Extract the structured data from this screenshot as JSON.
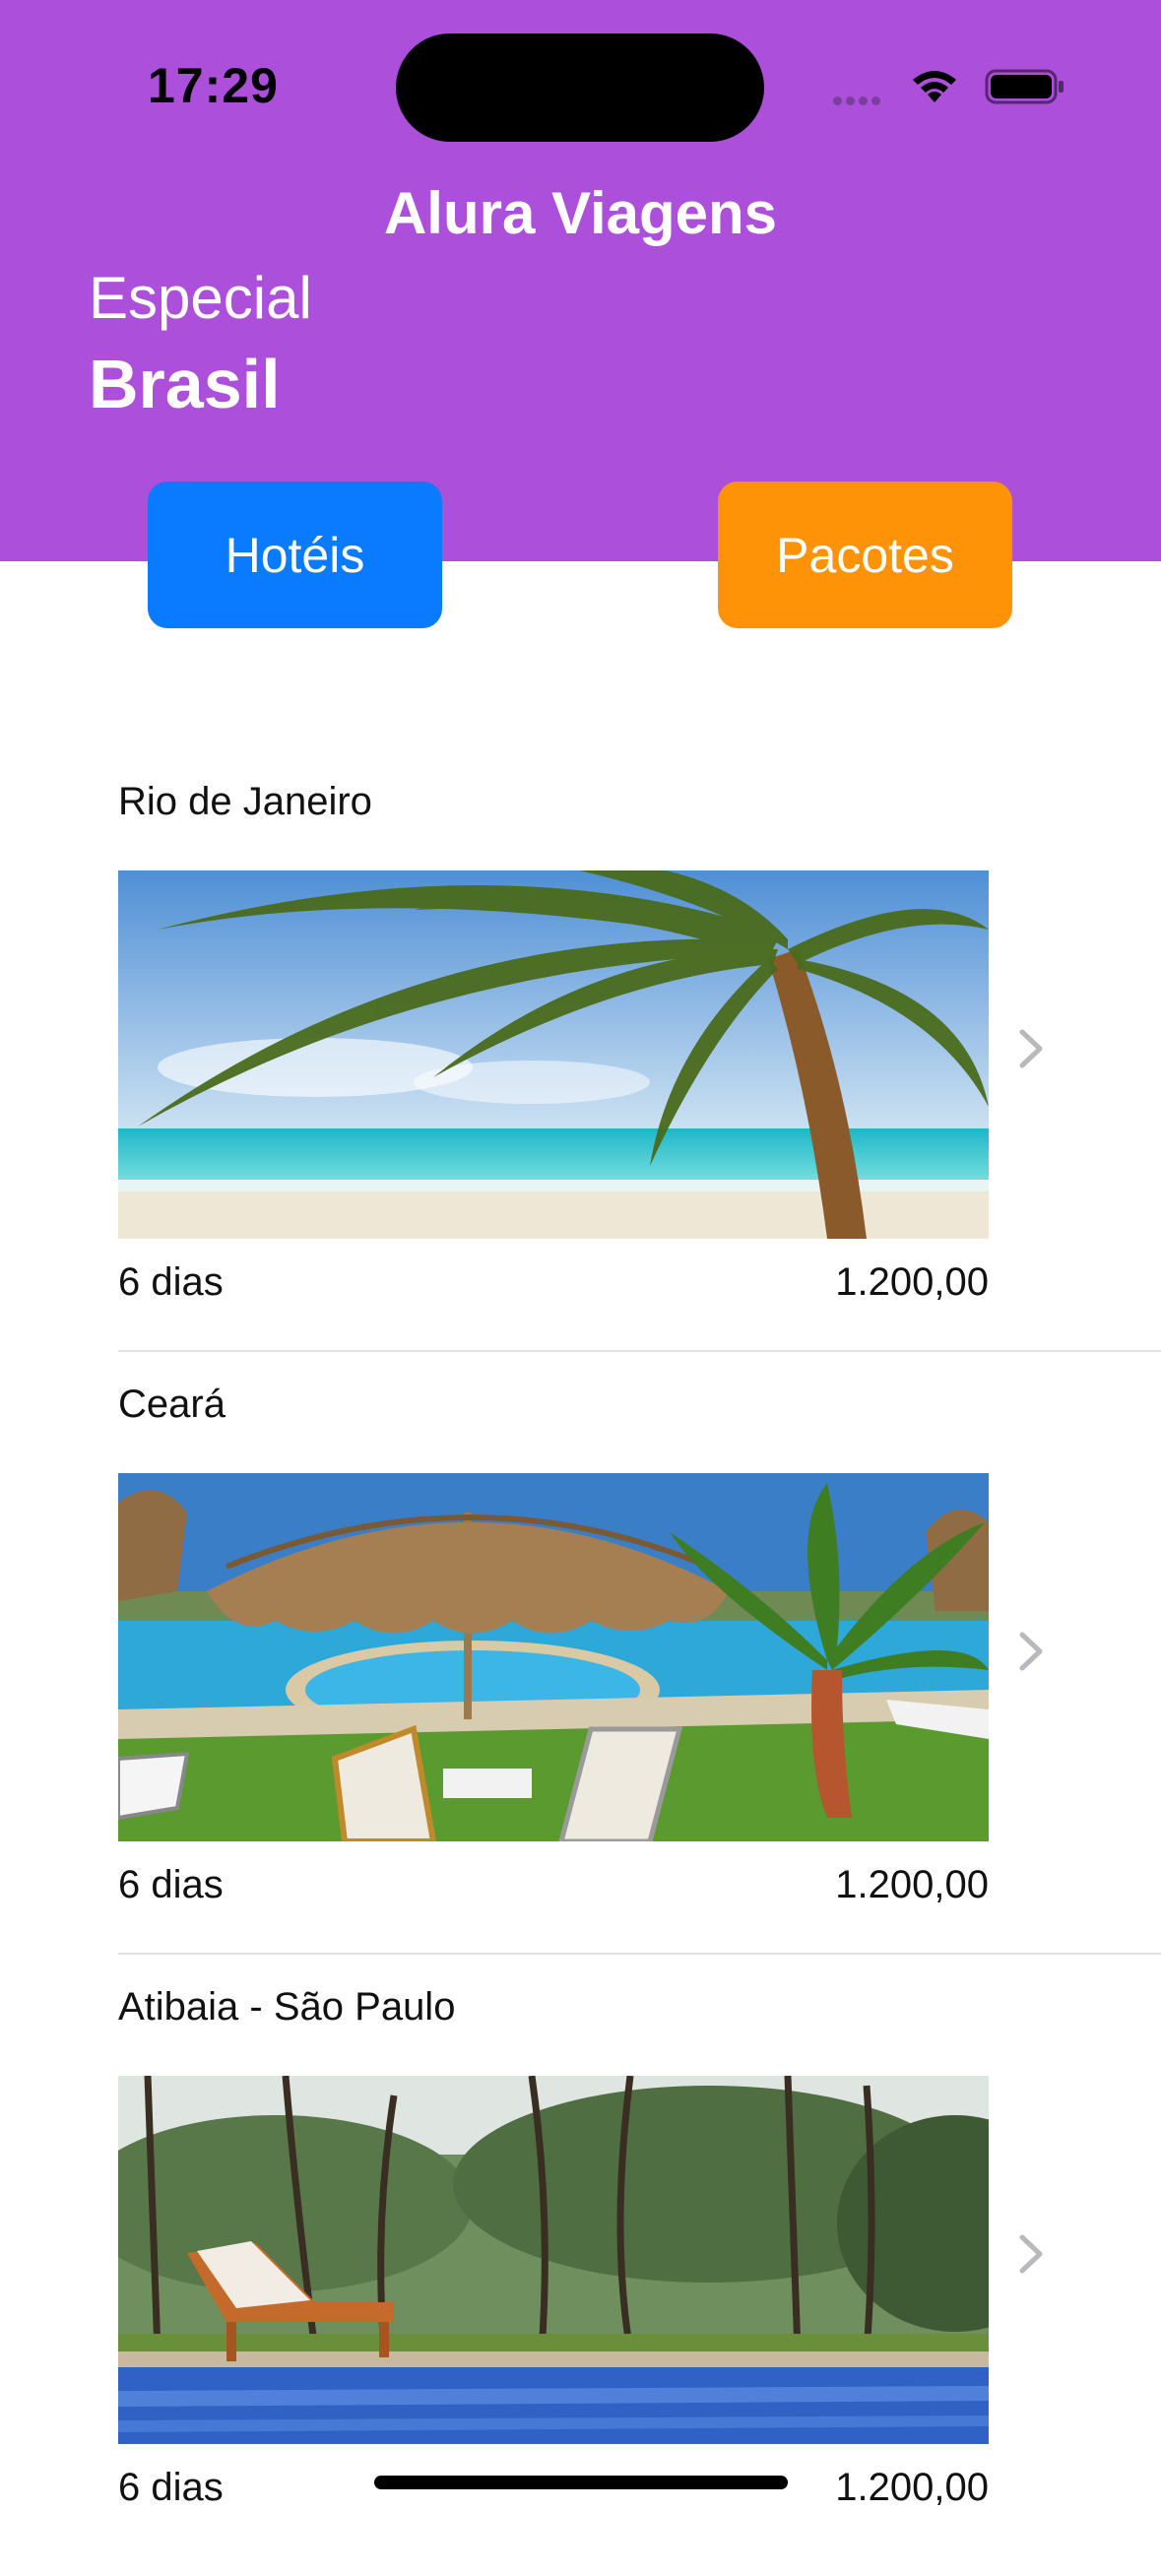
{
  "status_bar": {
    "time": "17:29"
  },
  "header": {
    "app_title": "Alura Viagens",
    "subtitle_line1": "Especial",
    "subtitle_line2": "Brasil",
    "accent_color": "#ac4fdb"
  },
  "buttons": {
    "hotels": {
      "label": "Hotéis",
      "color": "#0a7afe"
    },
    "packages": {
      "label": "Pacotes",
      "color": "#fe9307"
    }
  },
  "packages": [
    {
      "name": "Rio de Janeiro",
      "days": "6 dias",
      "price": "1.200,00",
      "image": "beach-palm-photo"
    },
    {
      "name": "Ceará",
      "days": "6 dias",
      "price": "1.200,00",
      "image": "pool-umbrella-photo"
    },
    {
      "name": "Atibaia - São Paulo",
      "days": "6 dias",
      "price": "1.200,00",
      "image": "forest-pool-photo"
    }
  ]
}
